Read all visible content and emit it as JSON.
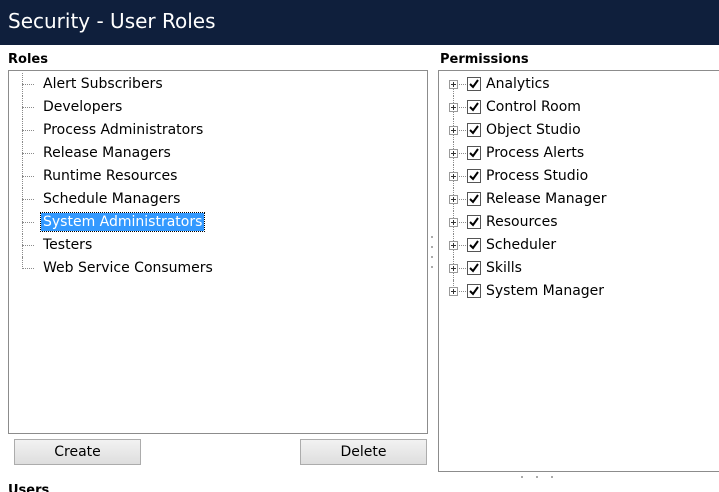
{
  "window": {
    "title": "Security - User Roles"
  },
  "roles": {
    "heading": "Roles",
    "items": [
      {
        "label": "Alert Subscribers",
        "selected": false
      },
      {
        "label": "Developers",
        "selected": false
      },
      {
        "label": "Process Administrators",
        "selected": false
      },
      {
        "label": "Release Managers",
        "selected": false
      },
      {
        "label": "Runtime Resources",
        "selected": false
      },
      {
        "label": "Schedule Managers",
        "selected": false
      },
      {
        "label": "System Administrators",
        "selected": true
      },
      {
        "label": "Testers",
        "selected": false
      },
      {
        "label": "Web Service Consumers",
        "selected": false
      }
    ],
    "create_label": "Create",
    "delete_label": "Delete"
  },
  "permissions": {
    "heading": "Permissions",
    "items": [
      {
        "label": "Analytics",
        "checked": true
      },
      {
        "label": "Control Room",
        "checked": true
      },
      {
        "label": "Object Studio",
        "checked": true
      },
      {
        "label": "Process Alerts",
        "checked": true
      },
      {
        "label": "Process Studio",
        "checked": true
      },
      {
        "label": "Release Manager",
        "checked": true
      },
      {
        "label": "Resources",
        "checked": true
      },
      {
        "label": "Scheduler",
        "checked": true
      },
      {
        "label": "Skills",
        "checked": true
      },
      {
        "label": "System Manager",
        "checked": true
      }
    ]
  },
  "users": {
    "heading": "Users"
  },
  "colors": {
    "title_bar": "#0f1f3c",
    "selection": "#3399ff"
  }
}
